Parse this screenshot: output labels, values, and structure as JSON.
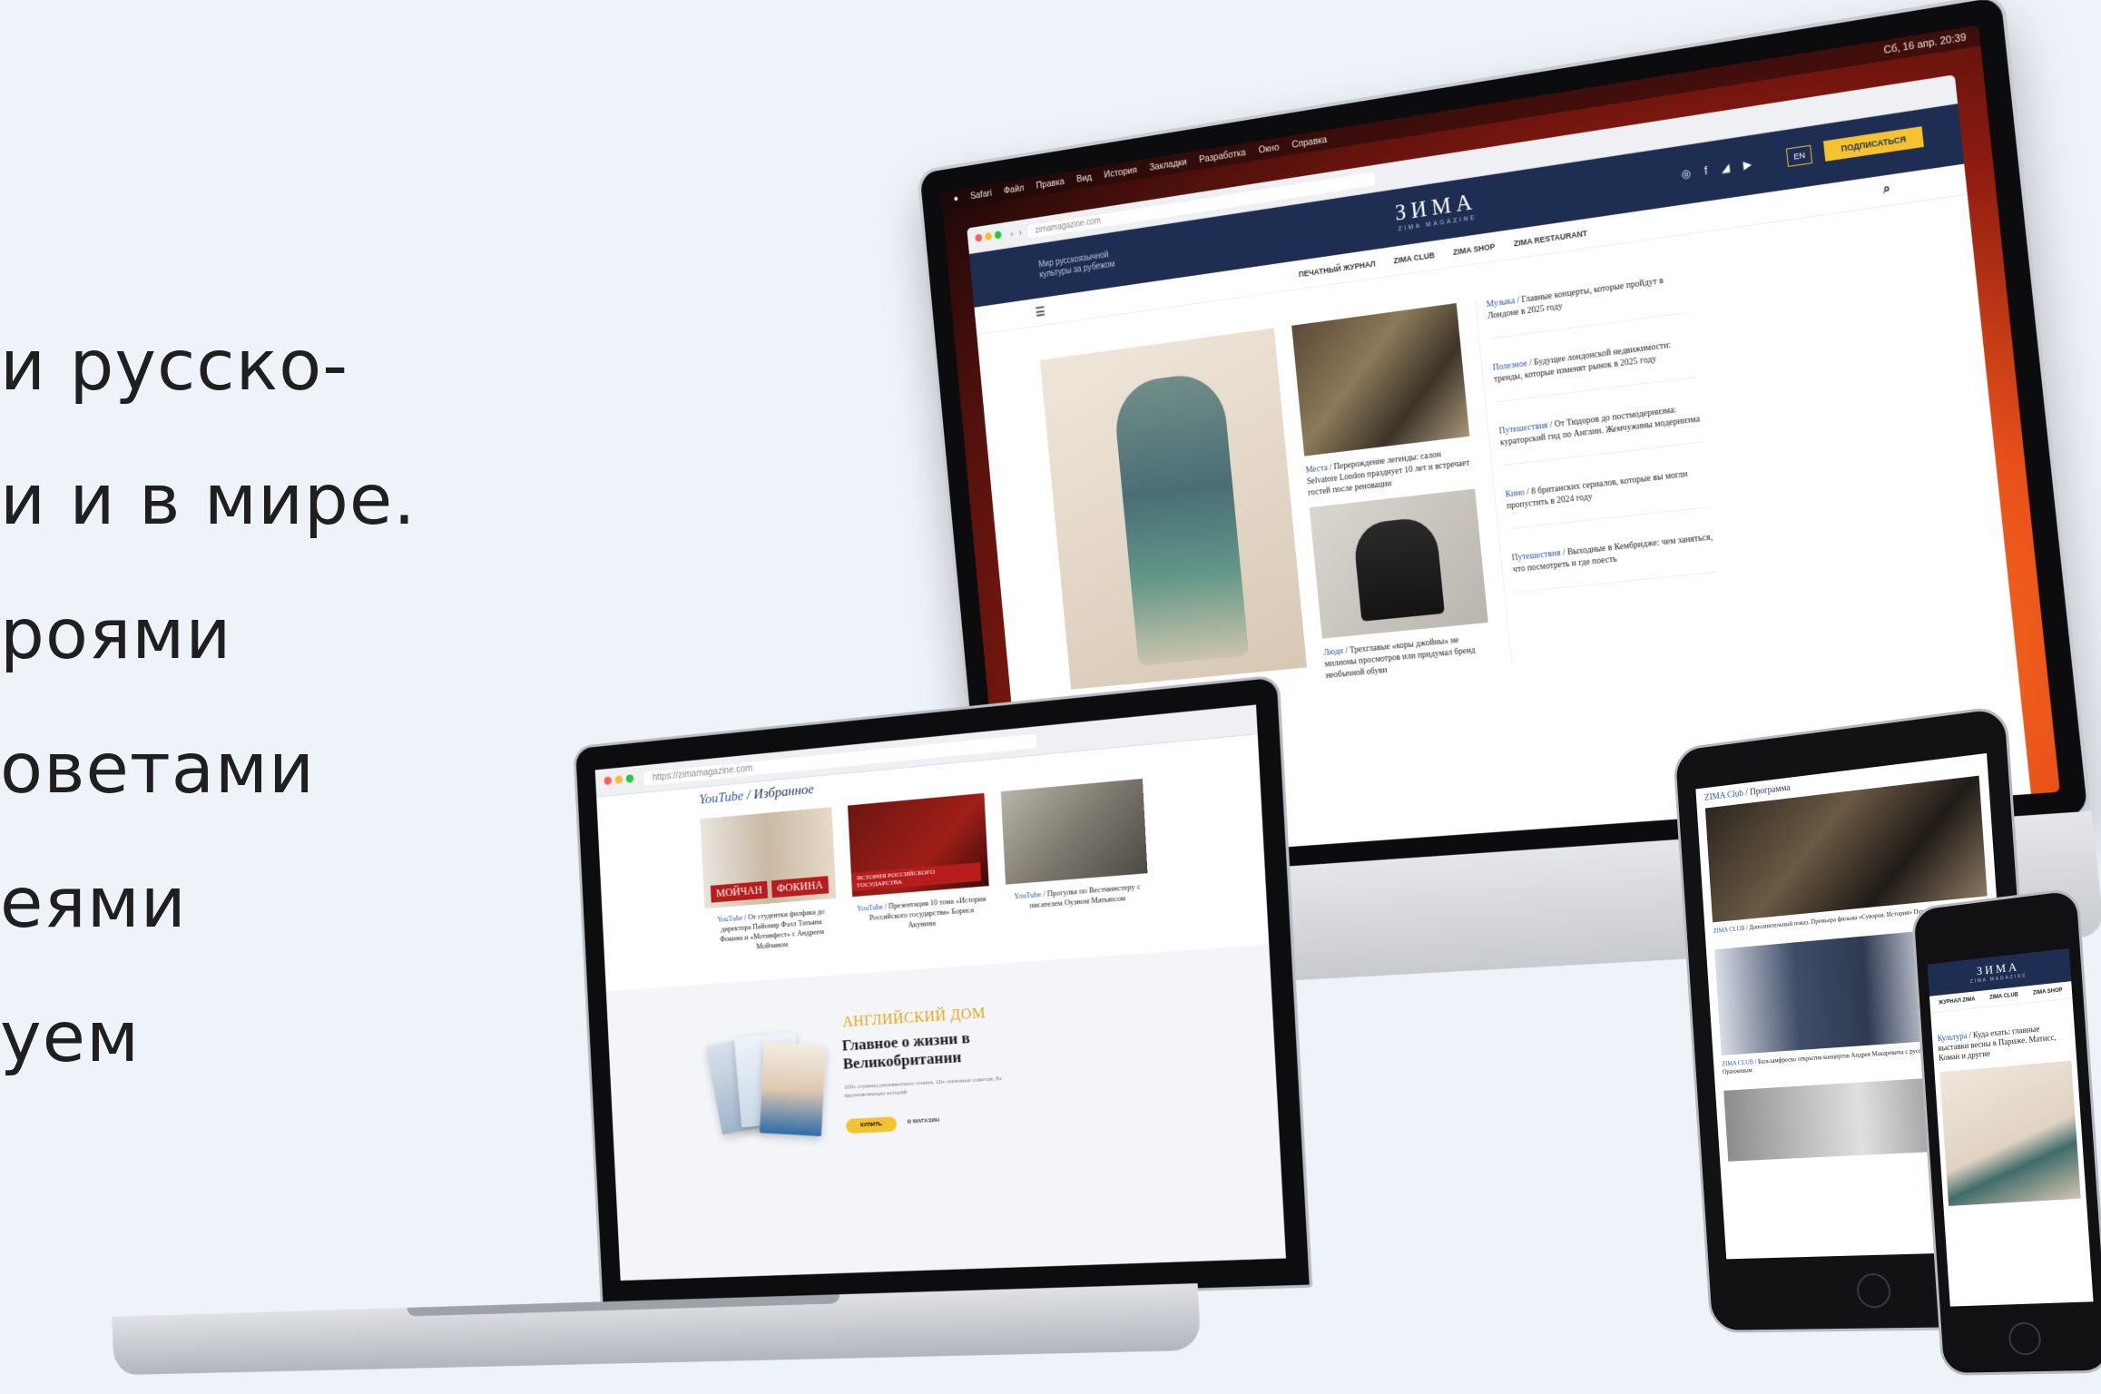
{
  "promo": {
    "lines": [
      "и русско-",
      "и и в мире.",
      "роями",
      "оветами",
      "еями",
      "уем"
    ]
  },
  "imac": {
    "menubar": {
      "items": [
        "Safari",
        "Файл",
        "Правка",
        "Вид",
        "История",
        "Закладки",
        "Разработка",
        "Окно",
        "Справка"
      ],
      "clock": "Сб, 16 апр. 20:39"
    },
    "browser": {
      "url": "zimamagazine.com"
    },
    "site": {
      "tagline": "Мир русскоязычной культуры за рубежом",
      "logo": "ЗИМА",
      "logo_sub": "ZIMA MAGAZINE",
      "social": "◎ f ◢ ▶",
      "lang": "EN",
      "subscribe": "ПОДПИСАТЬСЯ",
      "nav": [
        "ПЕЧАТНЫЙ ЖУРНАЛ",
        "ZIMA CLUB",
        "ZIMA SHOP",
        "ZIMA RESTAURANT"
      ]
    },
    "articles": {
      "c1_cat": "Места",
      "c1_text": " / Перерождение легенды: салон Selvatore London празднует 10 лет и встречает гостей после реновации",
      "c2_cat": "Люди",
      "c2_text": " / Трехглавые «коры джойны» не милионы просмотров или придумал бренд необычной обуви",
      "r1_cat": "Музыка",
      "r1_text": " / Главные концерты, которые пройдут в Лондоне в 2025 году",
      "r2_cat": "Полезное",
      "r2_text": " / Будущее лондонской недвижимости: тренды, которые изменят рынок в 2025 году",
      "r3_cat": "Путешествия",
      "r3_text": " / От Тюдоров до постмодернизма: кураторский гид по Англии. Жемчужины модернизма",
      "r4_cat": "Кино",
      "r4_text": " / 8 британских сериалов, которые вы могли пропустить в 2024 году",
      "r5_cat": "Путешествия",
      "r5_text": " / Выходные в Кембридже: чем заняться, что посмотреть и где поесть"
    }
  },
  "laptop": {
    "url": "https://zimamagazine.com",
    "section_cat": "YouTube",
    "section_title": " / Избранное",
    "cards": [
      {
        "label_left": "МОЙЧАН",
        "label_right": "ФОКИНА",
        "cat": "YouTube",
        "text": " / От студентки филфака до директора Пайонир Фэлл Татьяна Фокина и «Мотивфест» с Андреем Мойчаном"
      },
      {
        "label_left": "ИСТОРИЯ РОССИЙСКОГО ГОСУДАРСТВА",
        "label_right": "",
        "cat": "YouTube",
        "text": " / Презентация 10 тома «История Российского государства» Бориса Акунина"
      },
      {
        "label_left": "",
        "label_right": "",
        "cat": "YouTube",
        "text": " / Прогулка по Вестминстеру с писателем Оуэном Матьюсом"
      }
    ],
    "ad": {
      "kicker": "АНГЛИЙСКИЙ ДОМ",
      "title": "Главное о жизни в Великобритании",
      "text": "100+ страниц релевантного чтения, 10+ полезных советов, 8+ вдохновляющих историй",
      "buy": "КУПИТЬ",
      "shop": "В МАГАЗИН"
    }
  },
  "ipad": {
    "cat": "ZIMA Club",
    "title": " / Программа",
    "cap1_cat": "ZIMA CLUB",
    "cap1_text": " / Дополнительный показ. Премьера фильма «Суворов. История» Пушкиной в Лондоне",
    "cap2_cat": "ZIMA CLUB",
    "cap2_text": " / Бальзамфреско открытия концертов Андрея Макаревича с русскими Александром Оранжевым"
  },
  "iphone": {
    "logo": "ЗИМА",
    "logo_sub": "ZIMA MAGAZINE",
    "nav": [
      "ЖУРНАЛ ZIMA",
      "ZIMA CLUB",
      "ZIMA SHOP"
    ],
    "cap_cat": "Культура",
    "cap_text": " / Куда ехать: главные выставки весны в Париже. Матисс, Коман и другие"
  },
  "colors": {
    "background": "#eef2f9",
    "navy": "#1e2d52",
    "accent_yellow": "#f5c230",
    "link_blue": "#2a56a8"
  }
}
